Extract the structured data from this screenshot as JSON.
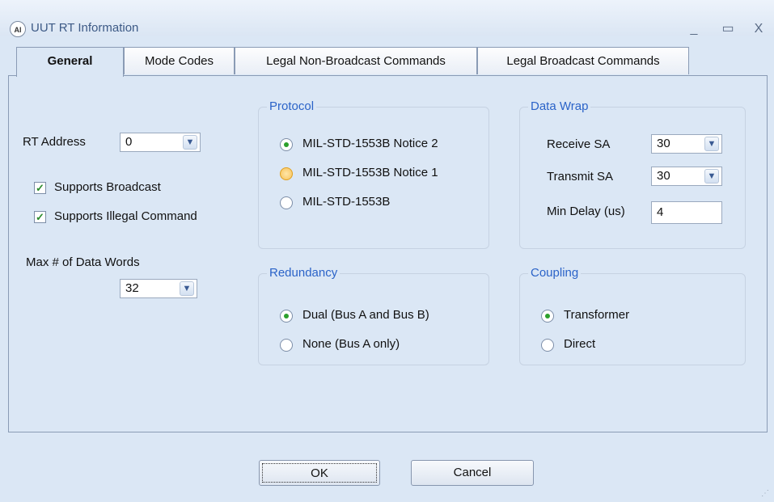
{
  "window": {
    "title": "UUT RT Information",
    "icon_text": "AI"
  },
  "controls": {
    "minimize": "_",
    "maximize": "▭",
    "close": "X"
  },
  "tabs": [
    "General",
    "Mode Codes",
    "Legal Non-Broadcast Commands",
    "Legal Broadcast Commands"
  ],
  "general": {
    "rt_address_label": "RT Address",
    "rt_address_value": "0",
    "supports_broadcast": {
      "label": "Supports Broadcast",
      "checked": true
    },
    "supports_illegal": {
      "label": "Supports Illegal Command",
      "checked": true
    },
    "max_words_label": "Max # of Data Words",
    "max_words_value": "32"
  },
  "protocol": {
    "title": "Protocol",
    "options": [
      "MIL-STD-1553B Notice 2",
      "MIL-STD-1553B Notice 1",
      "MIL-STD-1553B"
    ],
    "selected": 0
  },
  "data_wrap": {
    "title": "Data Wrap",
    "receive_sa_label": "Receive SA",
    "receive_sa_value": "30",
    "transmit_sa_label": "Transmit SA",
    "transmit_sa_value": "30",
    "min_delay_label": "Min Delay (us)",
    "min_delay_value": "4"
  },
  "redundancy": {
    "title": "Redundancy",
    "options": [
      "Dual (Bus A and Bus B)",
      "None (Bus A only)"
    ],
    "selected": 0
  },
  "coupling": {
    "title": "Coupling",
    "options": [
      "Transformer",
      "Direct"
    ],
    "selected": 0
  },
  "buttons": {
    "ok": "OK",
    "cancel": "Cancel"
  }
}
